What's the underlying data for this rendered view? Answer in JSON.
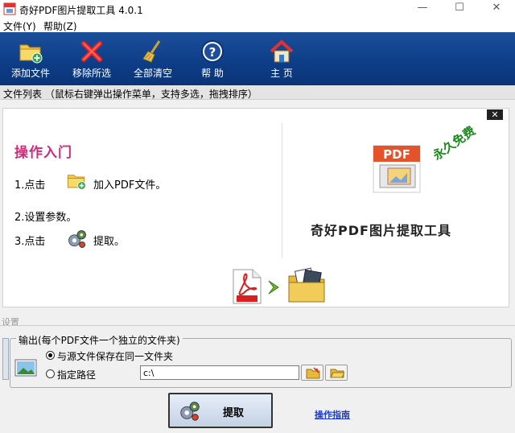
{
  "window": {
    "title": "奇好PDF图片提取工具 4.0.1",
    "min_glyph": "—",
    "max_glyph": "☐",
    "close_glyph": "✕"
  },
  "menu": {
    "items": [
      "文件(Y)",
      "帮助(Z)"
    ]
  },
  "toolbar": {
    "buttons": [
      {
        "label": "添加文件",
        "icon": "add-folder-icon"
      },
      {
        "label": "移除所选",
        "icon": "remove-x-icon"
      },
      {
        "label": "全部清空",
        "icon": "broom-icon"
      },
      {
        "label": "帮  助",
        "icon": "help-icon"
      },
      {
        "label": "主  页",
        "icon": "home-icon"
      }
    ]
  },
  "filelist": {
    "text": "文件列表  （鼠标右键弹出操作菜单，支持多选，拖拽排序）"
  },
  "guide": {
    "title": "操作入门",
    "step1_prefix": "1.点击",
    "step1_text": "加入PDF文件。",
    "step2": "2.设置参数。",
    "step3_prefix": "3.点击",
    "step3_text": "提取。",
    "close_glyph": "✕",
    "free_badge": "永久免费",
    "brand_title": "奇好PDF图片提取工具",
    "pdf_badge": "PDF"
  },
  "settings": {
    "label": "设置",
    "group_legend": "输出(每个PDF文件一个独立的文件夹)",
    "option_same": "与源文件保存在同一文件夹",
    "option_custom": "指定路径",
    "path_value": "c:\\",
    "selected": "same"
  },
  "actions": {
    "extract_label": "提取",
    "guide_link": "操作指南"
  },
  "colors": {
    "toolbar": "#0d3d86",
    "guide_title": "#d2287a",
    "free_badge": "#1a8a1a",
    "link": "#1a3bd6"
  }
}
